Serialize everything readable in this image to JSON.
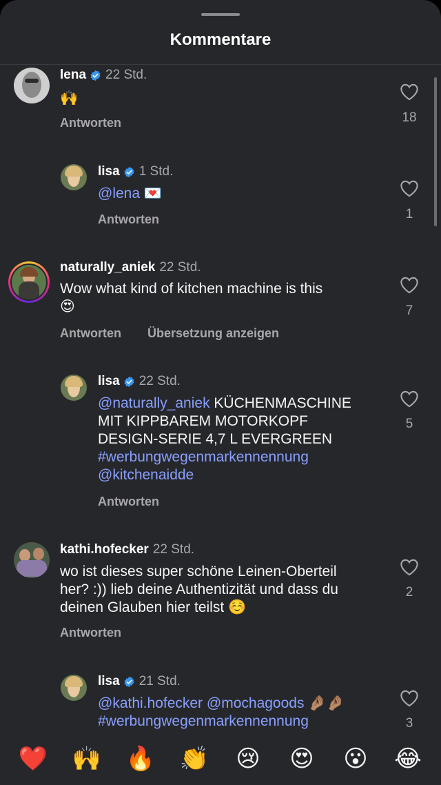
{
  "header": {
    "title": "Kommentare"
  },
  "comments": [
    {
      "user": "lena",
      "verified": true,
      "time": "22 Std.",
      "text": "🙌",
      "reply_label": "Antworten",
      "likes": "18"
    },
    {
      "user": "lisa",
      "verified": true,
      "time": "1 Std.",
      "mention": "@lena",
      "text": " 💌",
      "reply_label": "Antworten",
      "likes": "1"
    },
    {
      "user": "naturally_aniek",
      "verified": false,
      "time": "22 Std.",
      "text_line1": "Wow what kind of kitchen machine is this",
      "text_line2": "😍",
      "reply_label": "Antworten",
      "translate_label": "Übersetzung anzeigen",
      "likes": "7"
    },
    {
      "user": "lisa",
      "verified": true,
      "time": "22 Std.",
      "mention": "@naturally_aniek",
      "line1_rest": " KÜCHENMASCHINE",
      "line2": "MIT KIPPBAREM MOTORKOPF",
      "line3": "DESIGN-SERIE 4,7 L EVERGREEN",
      "hashtag": "#werbungwegenmarkennennung",
      "mention2": "@kitchenaidde",
      "reply_label": "Antworten",
      "likes": "5"
    },
    {
      "user": "kathi.hofecker",
      "verified": false,
      "time": "22 Std.",
      "line1": "wo ist dieses super schöne Leinen-Oberteil",
      "line2": "her? :)) lieb deine Authentizität und dass du",
      "line3": "deinen Glauben hier teilst ☺️",
      "reply_label": "Antworten",
      "likes": "2"
    },
    {
      "user": "lisa",
      "verified": true,
      "time": "21 Std.",
      "mention": "@kathi.hofecker",
      "mention2": "@mochagoods",
      "line1_rest": " 🤌🏽🤌🏽",
      "hashtag": "#werbungwegenmarkennennung",
      "likes": "3"
    }
  ],
  "emoji_bar": [
    "❤️",
    "🙌",
    "🔥",
    "👏",
    "😢",
    "😍",
    "😮",
    "😂"
  ],
  "colors": {
    "background": "#26272b",
    "mention": "#8aa0ff",
    "muted": "#a8a8ab",
    "verified": "#3897f0"
  }
}
